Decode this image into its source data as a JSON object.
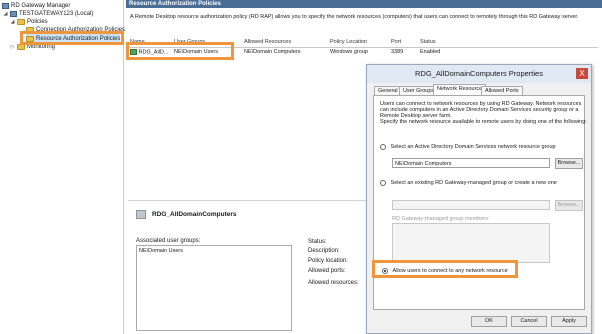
{
  "tree": {
    "root": "RD Gateway Manager",
    "server": "TESTGATEWAY123 (Local)",
    "policies": "Policies",
    "cap": "Connection Authorization Policies",
    "rap": "Resource Authorization Policies",
    "monitoring": "Monitoring"
  },
  "panel": {
    "title": "Resource Authorization Policies",
    "description": "A Remote Desktop resource authorization policy (RD RAP) allows you to specify the network resources (computers) that users can connect to remotely through this RD Gateway server.",
    "columns": [
      "Name",
      "User Groups",
      "Allowed Resources",
      "Policy Location",
      "Port",
      "Status"
    ],
    "row": {
      "name": "RDG_AllD...",
      "user_groups": "NE\\Domain Users",
      "allowed_resources": "NE\\Domain Computers",
      "policy_location": "Windows group",
      "port": "3389",
      "status": "Enabled"
    }
  },
  "details": {
    "title": "RDG_AllDomainComputers",
    "assoc_label": "Associated user groups:",
    "assoc_value": "NE\\Domain Users",
    "status_label": "Status:",
    "description_label": "Description:",
    "policy_location_label": "Policy location:",
    "allowed_ports_label": "Allowed ports:",
    "allowed_resources_label": "Allowed resources:"
  },
  "dialog": {
    "title": "RDG_AllDomainComputers Properties",
    "close": "X",
    "tabs": [
      "General",
      "User Groups",
      "Network Resource",
      "Allowed Ports"
    ],
    "intro": [
      "Users can connect to network resources by using RD Gateway. Network resources",
      "can include computers in an Active Directory Domain Services security group or a",
      "Remote Desktop server farm.",
      "Specify the network resource available to remote users by doing one of the following:"
    ],
    "opt1": "Select an Active Directory Domain Services network resource group",
    "opt1_value": "NE\\Domain Computers",
    "browse1": "Browse...",
    "opt2": "Select an existing RD Gateway-managed group or create a new one",
    "browse2": "Browse...",
    "members_label": "RD Gateway-managed group members:",
    "opt3": "Allow users to connect to any network resource",
    "ok": "OK",
    "cancel": "Cancel",
    "apply": "Apply"
  }
}
